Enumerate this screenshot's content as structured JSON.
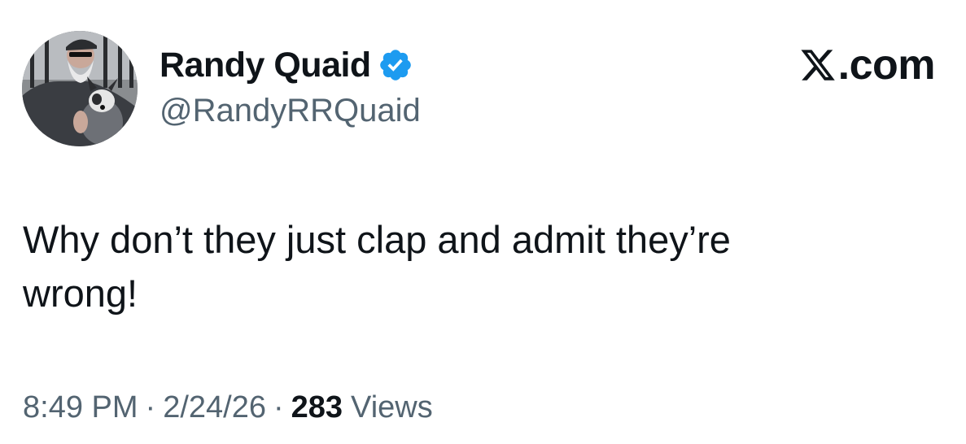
{
  "author": {
    "display_name": "Randy Quaid",
    "handle": "@RandyRRQuaid",
    "verified": true,
    "verified_color": "#1d9bf0"
  },
  "brand": {
    "label": ".com",
    "icon": "x-logo-icon"
  },
  "tweet": {
    "text": "Why don’t they just clap and admit they’re\nwrong!"
  },
  "meta": {
    "time": "8:49 PM",
    "date": "2/24/26",
    "separator": "·",
    "views_count": "283",
    "views_label": "Views"
  },
  "colors": {
    "text_primary": "#0f1419",
    "text_secondary": "#536471",
    "background": "#ffffff"
  }
}
